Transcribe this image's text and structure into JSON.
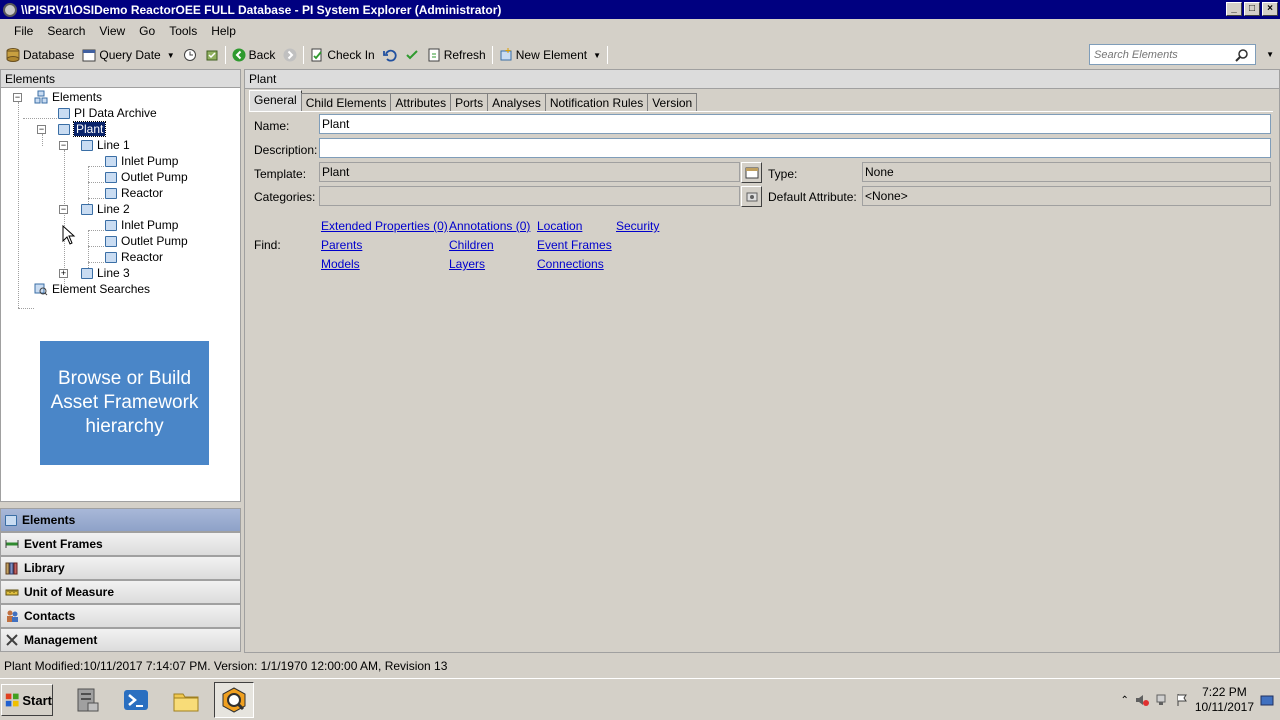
{
  "window": {
    "title": "\\\\PISRV1\\OSIDemo ReactorOEE FULL Database - PI System Explorer (Administrator)"
  },
  "menu": [
    "File",
    "Search",
    "View",
    "Go",
    "Tools",
    "Help"
  ],
  "toolbar": {
    "database": "Database",
    "query_date": "Query Date",
    "back": "Back",
    "check_in": "Check In",
    "refresh": "Refresh",
    "new_element": "New Element",
    "search_placeholder": "Search Elements"
  },
  "left": {
    "header": "Elements",
    "tree": {
      "root": "Elements",
      "archive": "PI Data Archive",
      "plant": "Plant",
      "line1": "Line 1",
      "line1_children": [
        "Inlet Pump",
        "Outlet Pump",
        "Reactor"
      ],
      "line2": "Line 2",
      "line2_children": [
        "Inlet Pump",
        "Outlet Pump",
        "Reactor"
      ],
      "line3": "Line 3",
      "searches": "Element Searches"
    },
    "promo": "Browse or Build Asset Framework hierarchy",
    "nav": [
      "Elements",
      "Event Frames",
      "Library",
      "Unit of Measure",
      "Contacts",
      "Management"
    ]
  },
  "right": {
    "header": "Plant",
    "tabs": [
      "General",
      "Child Elements",
      "Attributes",
      "Ports",
      "Analyses",
      "Notification Rules",
      "Version"
    ],
    "labels": {
      "name": "Name:",
      "description": "Description:",
      "template": "Template:",
      "type": "Type:",
      "categories": "Categories:",
      "default_attribute": "Default Attribute:",
      "find": "Find:"
    },
    "values": {
      "name": "Plant",
      "description": "",
      "template": "Plant",
      "type": "None",
      "categories": "",
      "default_attribute": "<None>"
    },
    "links": {
      "extended_properties": "Extended Properties (0)",
      "annotations": "Annotations (0)",
      "location": "Location",
      "security": "Security",
      "parents": "Parents",
      "children": "Children",
      "event_frames": "Event Frames",
      "models": "Models",
      "layers": "Layers",
      "connections": "Connections"
    }
  },
  "status": "Plant  Modified:10/11/2017 7:14:07 PM.  Version: 1/1/1970 12:00:00 AM, Revision 13",
  "taskbar": {
    "start": "Start",
    "time": "7:22 PM",
    "date": "10/11/2017"
  },
  "colors": {
    "titlebar": "#000080",
    "selection": "#0a246a",
    "promo": "#4a86c8",
    "link": "#0000cc"
  }
}
